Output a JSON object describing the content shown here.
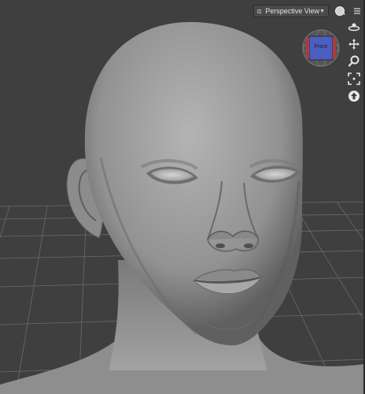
{
  "viewport": {
    "view_select": {
      "value": "Perspective View",
      "icon": "camera-icon"
    },
    "draw_style_icon": "sphere-shading-icon",
    "menu_icon": "hamburger-menu-icon",
    "cube": {
      "face_label": "Front",
      "face_color": "#4a5fc0"
    },
    "nav_tools": [
      "orbit-icon",
      "pan-icon",
      "zoom-icon",
      "frame-icon",
      "home-icon"
    ]
  }
}
